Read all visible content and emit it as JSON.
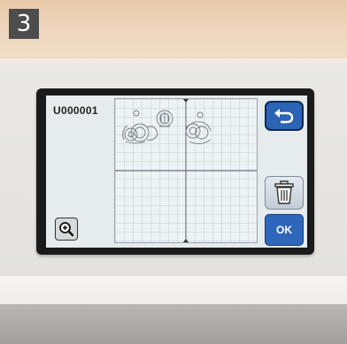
{
  "step_badge": "3",
  "screen": {
    "file_label": "U000001"
  },
  "icons": {
    "zoom": "zoom-in-magnifier-icon",
    "back": "return-arrow-icon",
    "delete": "trash-can-icon"
  },
  "buttons": {
    "ok_label": "OK"
  },
  "colors": {
    "screen_bg": "#e6ebee",
    "button_blue": "#2e66bb",
    "bezel": "#1b1b1c"
  }
}
